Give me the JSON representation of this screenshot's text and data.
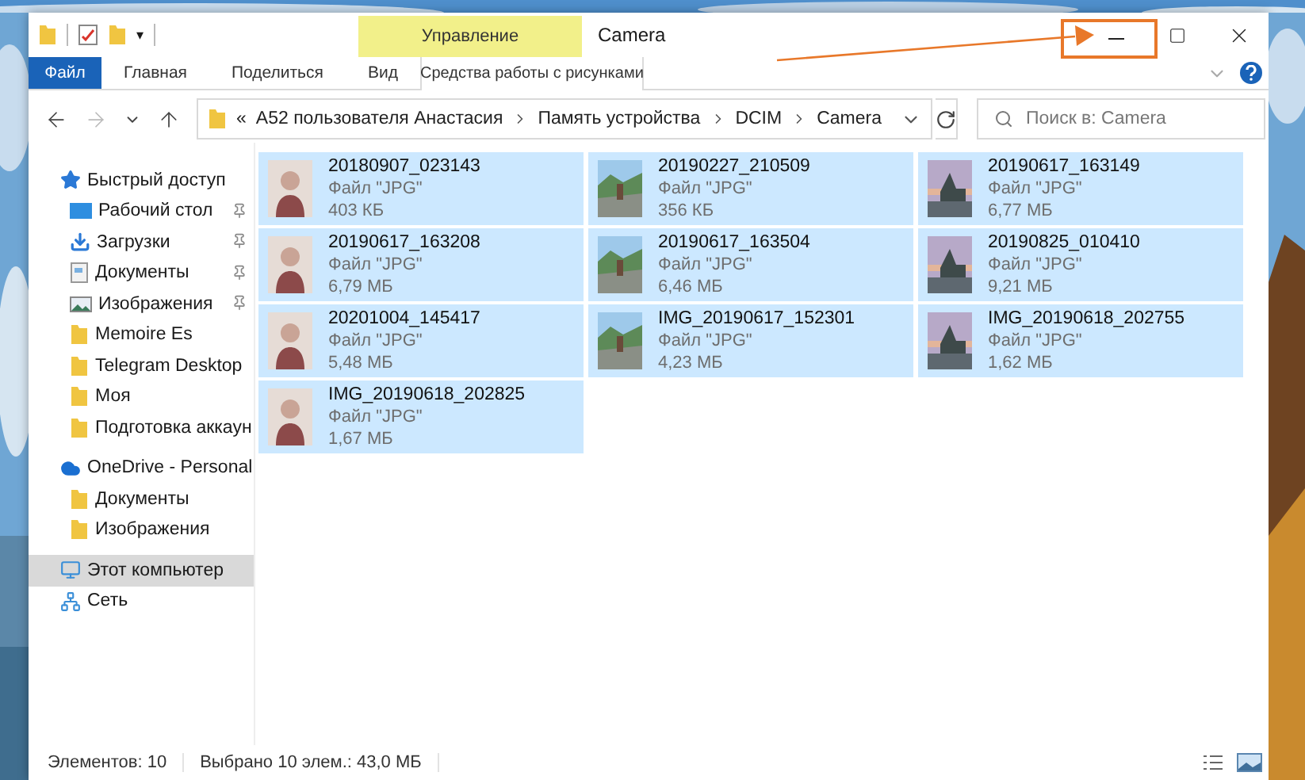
{
  "window": {
    "title": "Camera"
  },
  "quick_access_toolbar": {
    "dropdown": "▾"
  },
  "context_tab": {
    "header": "Управление",
    "label": "Средства работы с рисунками"
  },
  "ribbon_tabs": [
    {
      "label": "Файл",
      "kind": "file"
    },
    {
      "label": "Главная",
      "kind": "tab"
    },
    {
      "label": "Поделиться",
      "kind": "tab"
    },
    {
      "label": "Вид",
      "kind": "tab"
    }
  ],
  "address_bar": {
    "overflow": "«",
    "crumbs": [
      "A52 пользователя Анастасия",
      "Память устройства",
      "DCIM",
      "Camera"
    ]
  },
  "search": {
    "placeholder": "Поиск в: Camera"
  },
  "sidebar": {
    "items": [
      {
        "label": "Быстрый доступ",
        "kind": "star",
        "selected": false,
        "children": [
          {
            "label": "Рабочий стол",
            "kind": "desktop",
            "pinned": true,
            "selected": false
          },
          {
            "label": "Загрузки",
            "kind": "download",
            "pinned": true,
            "selected": false
          },
          {
            "label": "Документы",
            "kind": "documents",
            "pinned": true,
            "selected": false
          },
          {
            "label": "Изображения",
            "kind": "pictures",
            "pinned": true,
            "selected": false
          },
          {
            "label": "Memoire Es",
            "kind": "folder",
            "pinned": false,
            "selected": false
          },
          {
            "label": "Telegram Desktop",
            "kind": "folder",
            "pinned": false,
            "selected": false
          },
          {
            "label": "Моя",
            "kind": "folder",
            "pinned": false,
            "selected": false
          },
          {
            "label": "Подготовка аккаун",
            "kind": "folder",
            "pinned": false,
            "selected": false
          }
        ]
      },
      {
        "label": "OneDrive - Personal",
        "kind": "cloud",
        "selected": false,
        "children": [
          {
            "label": "Документы",
            "kind": "folder",
            "pinned": false,
            "selected": false
          },
          {
            "label": "Изображения",
            "kind": "folder",
            "pinned": false,
            "selected": false
          }
        ]
      },
      {
        "label": "Этот компьютер",
        "kind": "computer",
        "selected": true
      },
      {
        "label": "Сеть",
        "kind": "network",
        "selected": false
      }
    ]
  },
  "files": [
    {
      "name": "20180907_023143",
      "type": "Файл \"JPG\"",
      "size": "403 КБ",
      "selected": true
    },
    {
      "name": "20190227_210509",
      "type": "Файл \"JPG\"",
      "size": "356 КБ",
      "selected": true
    },
    {
      "name": "20190617_163149",
      "type": "Файл \"JPG\"",
      "size": "6,77 МБ",
      "selected": true
    },
    {
      "name": "20190617_163208",
      "type": "Файл \"JPG\"",
      "size": "6,79 МБ",
      "selected": true
    },
    {
      "name": "20190617_163504",
      "type": "Файл \"JPG\"",
      "size": "6,46 МБ",
      "selected": true
    },
    {
      "name": "20190825_010410",
      "type": "Файл \"JPG\"",
      "size": "9,21 МБ",
      "selected": true
    },
    {
      "name": "20201004_145417",
      "type": "Файл \"JPG\"",
      "size": "5,48 МБ",
      "selected": true
    },
    {
      "name": "IMG_20190617_152301",
      "type": "Файл \"JPG\"",
      "size": "4,23 МБ",
      "selected": true
    },
    {
      "name": "IMG_20190618_202755",
      "type": "Файл \"JPG\"",
      "size": "1,62 МБ",
      "selected": true
    },
    {
      "name": "IMG_20190618_202825",
      "type": "Файл \"JPG\"",
      "size": "1,67 МБ",
      "selected": true
    }
  ],
  "status_bar": {
    "items_count": "Элементов: 10",
    "selection": "Выбрано 10 элем.: 43,0 МБ"
  }
}
